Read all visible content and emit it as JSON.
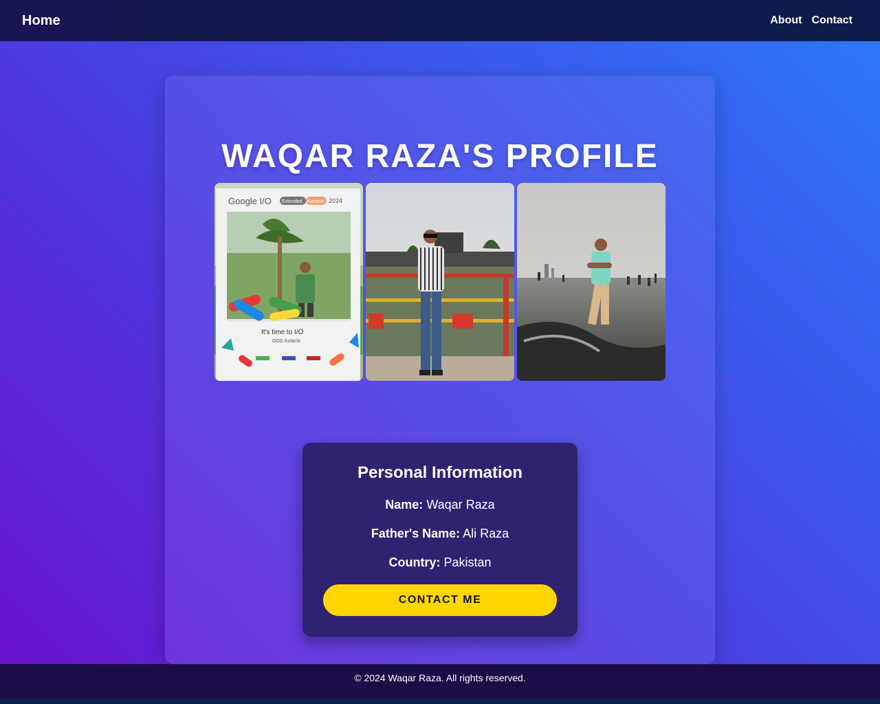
{
  "nav": {
    "home": "Home",
    "links": [
      "About",
      "Contact"
    ]
  },
  "profile": {
    "title": "WAQAR RAZA'S PROFILE",
    "photos": [
      {
        "caption_top": "Google I/O",
        "caption_badge_1": "Extended",
        "caption_badge_2": "Karachi",
        "caption_year": "2024",
        "caption_bottom": "It's time to I/O",
        "caption_sub": "GDG Kolachi"
      },
      {},
      {}
    ]
  },
  "info": {
    "heading": "Personal Information",
    "rows": [
      {
        "label": "Name:",
        "value": "Waqar Raza"
      },
      {
        "label": "Father's Name:",
        "value": "Ali Raza"
      },
      {
        "label": "Country:",
        "value": "Pakistan"
      }
    ],
    "button": "CONTACT ME"
  },
  "footer": "© 2024 Waqar Raza. All rights reserved."
}
